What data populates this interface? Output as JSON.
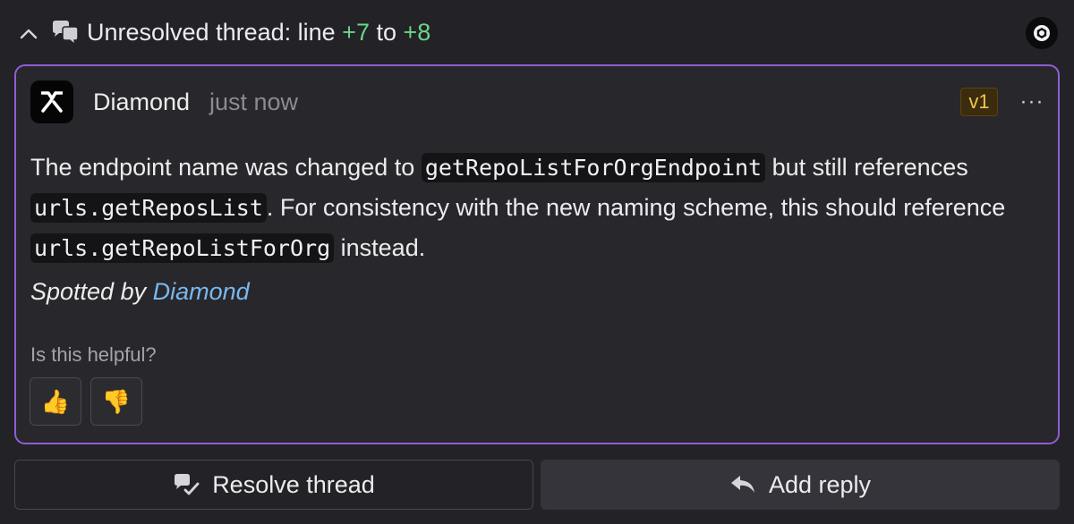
{
  "header": {
    "title_prefix": "Unresolved thread: line ",
    "line_start": "+7",
    "line_sep": " to ",
    "line_end": "+8",
    "collapse_icon": "chevron-up-icon",
    "thread_icon": "chat-bubbles-icon",
    "status_icon": "aperture-icon"
  },
  "comment": {
    "author": "Diamond",
    "time": "just now",
    "version": "v1",
    "more_label": "···",
    "avatar_icon": "diamond-logo-icon",
    "body": {
      "t1": "The endpoint name was changed to ",
      "code1": "getRepoListForOrgEndpoint",
      "t2": " but still references ",
      "code2": "urls.getReposList",
      "t3": ". For consistency with the new naming scheme, this should reference ",
      "code3": "urls.getRepoListForOrg",
      "t4": " instead."
    },
    "spotted_prefix": "Spotted by ",
    "spotted_link": "Diamond",
    "helpful_question": "Is this helpful?",
    "thumbs_up": "👍",
    "thumbs_down": "👎"
  },
  "actions": {
    "resolve_label": "Resolve thread",
    "reply_label": "Add reply",
    "resolve_icon": "resolve-chat-icon",
    "reply_icon": "reply-arrow-icon"
  },
  "colors": {
    "card_border": "#8e5fd6",
    "line_number": "#6bd58a",
    "link": "#7ab8ee",
    "badge_text": "#f3c44e"
  }
}
